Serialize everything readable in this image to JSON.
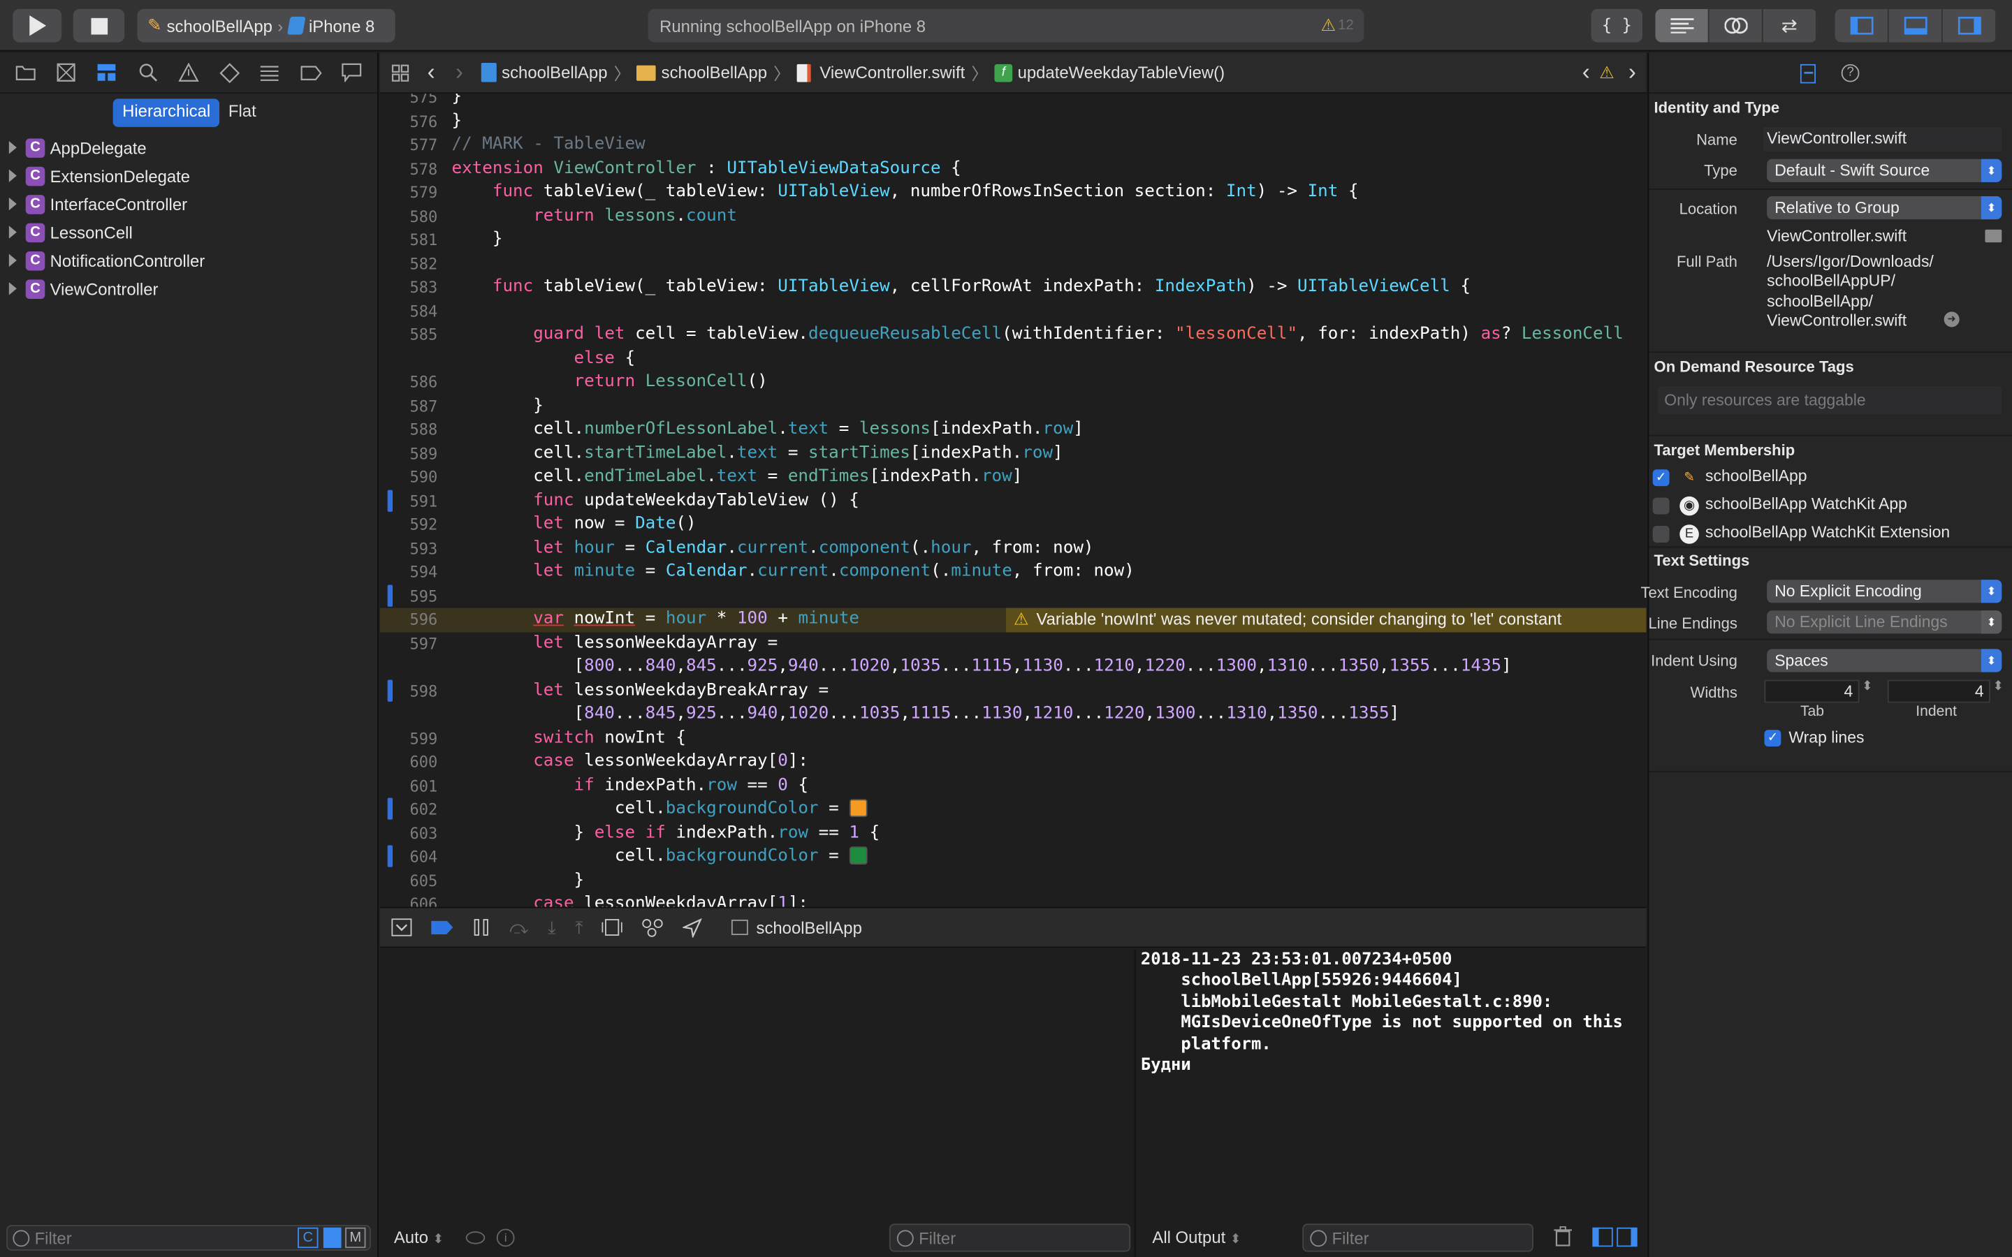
{
  "toolbar": {
    "scheme_app": "schoolBellApp",
    "scheme_device": "iPhone 8",
    "activity": "Running schoolBellApp on iPhone 8",
    "activity_warn": "12"
  },
  "navigator": {
    "mode_hier": "Hierarchical",
    "mode_flat": "Flat",
    "items": [
      "AppDelegate",
      "ExtensionDelegate",
      "InterfaceController",
      "LessonCell",
      "NotificationController",
      "ViewController"
    ],
    "badge": "C",
    "filter_placeholder": "Filter"
  },
  "jumpbar": {
    "project": "schoolBellApp",
    "group": "schoolBellApp",
    "file": "ViewController.swift",
    "func": "updateWeekdayTableView()"
  },
  "editor": {
    "warning": "Variable 'nowInt' was never mutated; consider changing to 'let' constant",
    "swatch_colors": [
      "#f59a23",
      "#1e8c3f"
    ],
    "lines": [
      {
        "n": "575",
        "c": "}"
      },
      {
        "n": "576",
        "c": "}"
      },
      {
        "n": "577",
        "c": "// MARK - TableView"
      },
      {
        "n": "578",
        "c": "extension ViewController : UITableViewDataSource {"
      },
      {
        "n": "579",
        "c": "    func tableView(_ tableView: UITableView, numberOfRowsInSection section: Int) -> Int {"
      },
      {
        "n": "580",
        "c": "        return lessons.count"
      },
      {
        "n": "581",
        "c": "    }"
      },
      {
        "n": "582",
        "c": ""
      },
      {
        "n": "583",
        "c": "    func tableView(_ tableView: UITableView, cellForRowAt indexPath: IndexPath) -> UITableViewCell {"
      },
      {
        "n": "584",
        "c": ""
      },
      {
        "n": "585",
        "c": "        guard let cell = tableView.dequeueReusableCell(withIdentifier: \"lessonCell\", for: indexPath) as? LessonCell"
      },
      {
        "n": "",
        "c": "            else {"
      },
      {
        "n": "586",
        "c": "            return LessonCell()"
      },
      {
        "n": "587",
        "c": "        }"
      },
      {
        "n": "588",
        "c": "        cell.numberOfLessonLabel.text = lessons[indexPath.row]"
      },
      {
        "n": "589",
        "c": "        cell.startTimeLabel.text = startTimes[indexPath.row]"
      },
      {
        "n": "590",
        "c": "        cell.endTimeLabel.text = endTimes[indexPath.row]"
      },
      {
        "n": "591",
        "c": "        func updateWeekdayTableView () {"
      },
      {
        "n": "592",
        "c": "        let now = Date()"
      },
      {
        "n": "593",
        "c": "        let hour = Calendar.current.component(.hour, from: now)"
      },
      {
        "n": "594",
        "c": "        let minute = Calendar.current.component(.minute, from: now)"
      },
      {
        "n": "595",
        "c": ""
      },
      {
        "n": "596",
        "c": "        var nowInt = hour * 100 + minute"
      },
      {
        "n": "597",
        "c": "        let lessonWeekdayArray ="
      },
      {
        "n": "",
        "c": "            [800...840,845...925,940...1020,1035...1115,1130...1210,1220...1300,1310...1350,1355...1435]"
      },
      {
        "n": "598",
        "c": "        let lessonWeekdayBreakArray ="
      },
      {
        "n": "",
        "c": "            [840...845,925...940,1020...1035,1115...1130,1210...1220,1300...1310,1350...1355]"
      },
      {
        "n": "599",
        "c": "        switch nowInt {"
      },
      {
        "n": "600",
        "c": "        case lessonWeekdayArray[0]:"
      },
      {
        "n": "601",
        "c": "            if indexPath.row == 0 {"
      },
      {
        "n": "602",
        "c": "                cell.backgroundColor = "
      },
      {
        "n": "603",
        "c": "            } else if indexPath.row == 1 {"
      },
      {
        "n": "604",
        "c": "                cell.backgroundColor = "
      },
      {
        "n": "605",
        "c": "            }"
      },
      {
        "n": "606",
        "c": "        case lessonWeekdayArray[1]:"
      }
    ]
  },
  "debug": {
    "process": "schoolBellApp"
  },
  "console": {
    "text": "2018-11-23 23:53:01.007234+0500\n    schoolBellApp[55926:9446604]\n    libMobileGestalt MobileGestalt.c:890:\n    MGIsDeviceOneOfType is not supported on this\n    platform.\nБудни"
  },
  "bottom": {
    "auto": "Auto",
    "filter": "Filter",
    "all_output": "All Output"
  },
  "inspector": {
    "identity_title": "Identity and Type",
    "name_label": "Name",
    "name_value": "ViewController.swift",
    "type_label": "Type",
    "type_value": "Default - Swift Source",
    "location_label": "Location",
    "location_value": "Relative to Group",
    "location_file": "ViewController.swift",
    "fullpath_label": "Full Path",
    "fullpath_lines": [
      "/Users/Igor/Downloads/",
      "schoolBellAppUP/",
      "schoolBellApp/",
      "ViewController.swift"
    ],
    "odr_title": "On Demand Resource Tags",
    "odr_placeholder": "Only resources are taggable",
    "target_title": "Target Membership",
    "targets": [
      {
        "label": "schoolBellApp",
        "checked": true
      },
      {
        "label": "schoolBellApp WatchKit App",
        "checked": false
      },
      {
        "label": "schoolBellApp WatchKit Extension",
        "checked": false
      }
    ],
    "text_title": "Text Settings",
    "encoding_label": "Text Encoding",
    "encoding_value": "No Explicit Encoding",
    "endings_label": "Line Endings",
    "endings_value": "No Explicit Line Endings",
    "indent_label": "Indent Using",
    "indent_value": "Spaces",
    "widths_label": "Widths",
    "tab_value": "4",
    "indent_width_value": "4",
    "tab_label": "Tab",
    "indent_col_label": "Indent",
    "wrap_label": "Wrap lines"
  }
}
